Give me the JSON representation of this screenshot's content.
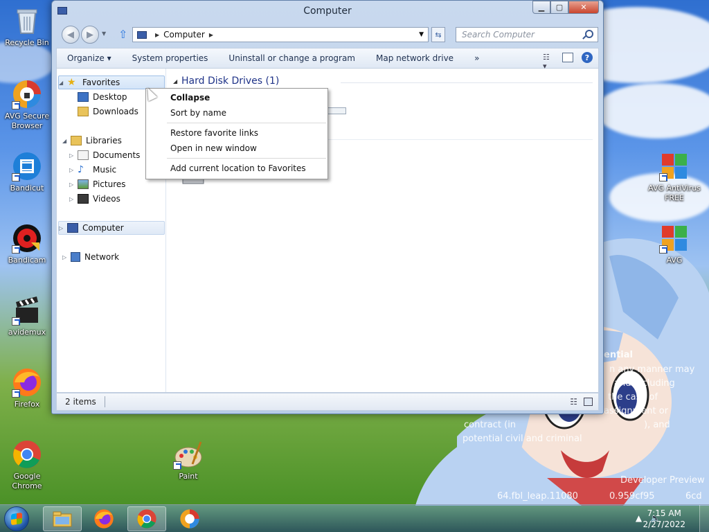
{
  "desktop": {
    "icons": [
      {
        "label": "Recycle Bin"
      },
      {
        "label": "AVG Secure Browser"
      },
      {
        "label": "Bandicut"
      },
      {
        "label": "Bandicam"
      },
      {
        "label": "avidemux"
      },
      {
        "label": "Firefox"
      },
      {
        "label": "Google Chrome"
      },
      {
        "label": "Paint"
      },
      {
        "label": "AVG AntiVirus FREE"
      },
      {
        "label": "AVG"
      }
    ],
    "watermark": {
      "line1": "ential",
      "line2": "n any manner may",
      "line3": "and including",
      "line4": "the case of",
      "line5": "assignment or",
      "line6": "contract (in",
      "line7": "), and",
      "line8": "potential civil and criminal",
      "line9": "Developer Preview",
      "line10": "64.fbl_leap.11080",
      "line11": "0.959cf95",
      "line12": "6cd"
    }
  },
  "window": {
    "title": "Computer",
    "controls": {
      "minimize": "▁",
      "maximize": "▢",
      "close": "✕"
    },
    "address": {
      "segment": "Computer"
    },
    "search": {
      "placeholder": "Search Computer"
    },
    "toolbar": {
      "organize": "Organize ▾",
      "system_properties": "System properties",
      "uninstall": "Uninstall or change a program",
      "map_drive": "Map network drive",
      "more": "»"
    },
    "nav": {
      "favorites": "Favorites",
      "desktop": "Desktop",
      "downloads": "Downloads",
      "libraries": "Libraries",
      "documents": "Documents",
      "music": "Music",
      "pictures": "Pictures",
      "videos": "Videos",
      "computer": "Computer",
      "network": "Network"
    },
    "content": {
      "group_header": "Hard Disk Drives (1)"
    },
    "status": {
      "items": "2 items"
    }
  },
  "context_menu": {
    "items": [
      {
        "label": "Collapse"
      },
      {
        "label": "Sort by name"
      },
      {
        "label": "Restore favorite links"
      },
      {
        "label": "Open in new window"
      },
      {
        "label": "Add current location to Favorites"
      }
    ]
  },
  "taskbar": {
    "clock": {
      "time": "7:15 AM",
      "date": "2/27/2022"
    }
  }
}
